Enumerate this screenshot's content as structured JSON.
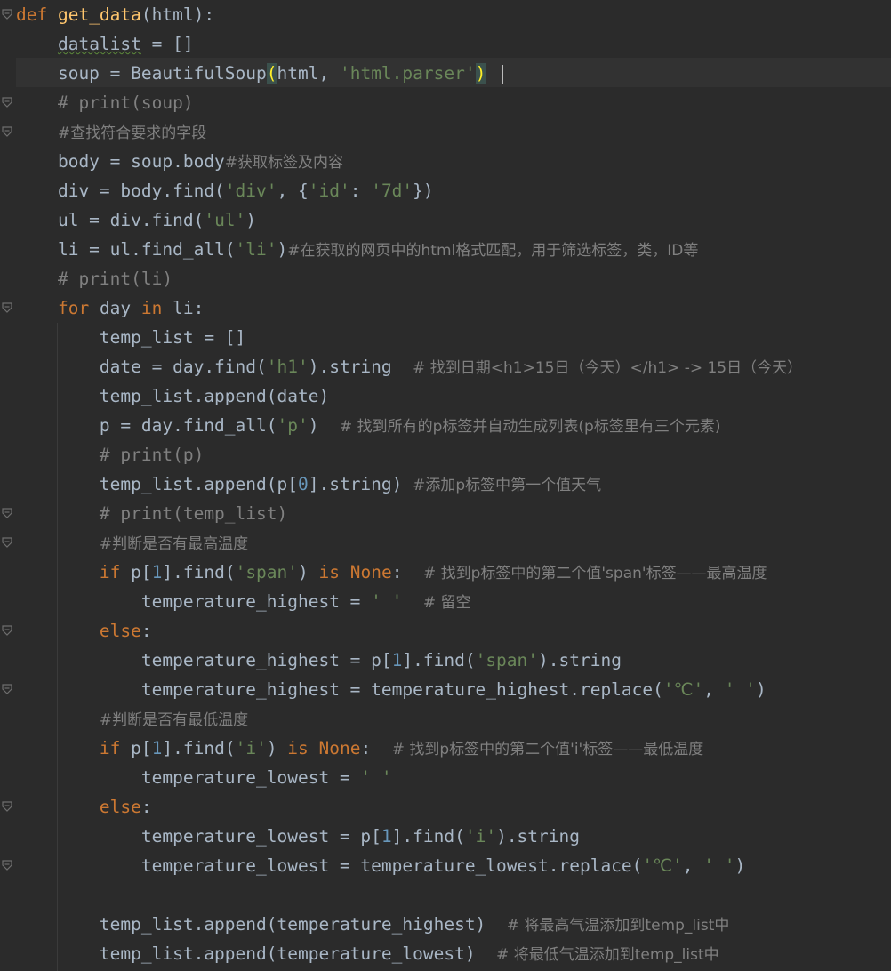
{
  "code_lines": [
    [
      {
        "c": "kw",
        "t": "def "
      },
      {
        "c": "fn",
        "t": "get_data"
      },
      {
        "c": "plain",
        "t": "(html):"
      }
    ],
    [
      {
        "c": "plain",
        "t": "    "
      },
      {
        "c": "plain sq",
        "t": "datalist"
      },
      {
        "c": "plain",
        "t": " = []"
      }
    ],
    [
      {
        "c": "plain",
        "t": "    soup = BeautifulSoup"
      },
      {
        "c": "paren-hl",
        "t": "("
      },
      {
        "c": "plain",
        "t": "html, "
      },
      {
        "c": "str",
        "t": "'html.parser'"
      },
      {
        "c": "paren-hl",
        "t": ")"
      }
    ],
    [
      {
        "c": "plain",
        "t": "    "
      },
      {
        "c": "cm",
        "t": "# print(soup)"
      }
    ],
    [
      {
        "c": "plain",
        "t": "    "
      },
      {
        "c": "cm-cjk",
        "t": "#查找符合要求的字段"
      }
    ],
    [
      {
        "c": "plain",
        "t": "    body = soup.body"
      },
      {
        "c": "cm-cjk",
        "t": "#获取标签及内容"
      }
    ],
    [
      {
        "c": "plain",
        "t": "    div = body.find("
      },
      {
        "c": "str",
        "t": "'div'"
      },
      {
        "c": "plain",
        "t": ", {"
      },
      {
        "c": "str",
        "t": "'id'"
      },
      {
        "c": "plain",
        "t": ": "
      },
      {
        "c": "str",
        "t": "'7d'"
      },
      {
        "c": "plain",
        "t": "})"
      }
    ],
    [
      {
        "c": "plain",
        "t": "    ul = div.find("
      },
      {
        "c": "str",
        "t": "'ul'"
      },
      {
        "c": "plain",
        "t": ")"
      }
    ],
    [
      {
        "c": "plain",
        "t": "    li = ul.find_all("
      },
      {
        "c": "str",
        "t": "'li'"
      },
      {
        "c": "plain",
        "t": ")"
      },
      {
        "c": "cm-cjk",
        "t": "#在获取的网页中的html格式匹配，用于筛选标签，类，ID等"
      }
    ],
    [
      {
        "c": "plain",
        "t": "    "
      },
      {
        "c": "cm",
        "t": "# print(li)"
      }
    ],
    [
      {
        "c": "plain",
        "t": "    "
      },
      {
        "c": "kw",
        "t": "for"
      },
      {
        "c": "plain",
        "t": " day "
      },
      {
        "c": "kw",
        "t": "in"
      },
      {
        "c": "plain",
        "t": " li:"
      }
    ],
    [
      {
        "c": "plain",
        "t": "        temp_list = []"
      }
    ],
    [
      {
        "c": "plain",
        "t": "        date = day.find("
      },
      {
        "c": "str",
        "t": "'h1'"
      },
      {
        "c": "plain",
        "t": ").string  "
      },
      {
        "c": "cm-cjk",
        "t": "# 找到日期<h1>15日（今天）</h1> -> 15日（今天）"
      }
    ],
    [
      {
        "c": "plain",
        "t": "        temp_list.append(date)"
      }
    ],
    [
      {
        "c": "plain",
        "t": "        p = day.find_all("
      },
      {
        "c": "str",
        "t": "'p'"
      },
      {
        "c": "plain",
        "t": ")  "
      },
      {
        "c": "cm-cjk",
        "t": "# 找到所有的p标签并自动生成列表(p标签里有三个元素)"
      }
    ],
    [
      {
        "c": "plain",
        "t": "        "
      },
      {
        "c": "cm",
        "t": "# print(p)"
      }
    ],
    [
      {
        "c": "plain",
        "t": "        temp_list.append(p["
      },
      {
        "c": "num",
        "t": "0"
      },
      {
        "c": "plain",
        "t": "].string) "
      },
      {
        "c": "cm-cjk",
        "t": "#添加p标签中第一个值天气"
      }
    ],
    [
      {
        "c": "plain",
        "t": "        "
      },
      {
        "c": "cm",
        "t": "# print(temp_list)"
      }
    ],
    [
      {
        "c": "plain",
        "t": "        "
      },
      {
        "c": "cm-cjk",
        "t": "#判断是否有最高温度"
      }
    ],
    [
      {
        "c": "plain",
        "t": "        "
      },
      {
        "c": "kw",
        "t": "if"
      },
      {
        "c": "plain",
        "t": " p["
      },
      {
        "c": "num",
        "t": "1"
      },
      {
        "c": "plain",
        "t": "].find("
      },
      {
        "c": "str",
        "t": "'span'"
      },
      {
        "c": "plain",
        "t": ") "
      },
      {
        "c": "kw",
        "t": "is None"
      },
      {
        "c": "plain",
        "t": ":  "
      },
      {
        "c": "cm-cjk",
        "t": "# 找到p标签中的第二个值'span'标签——最高温度"
      }
    ],
    [
      {
        "c": "plain",
        "t": "            temperature_highest = "
      },
      {
        "c": "str",
        "t": "' '"
      },
      {
        "c": "plain",
        "t": "  "
      },
      {
        "c": "cm-cjk",
        "t": "# 留空"
      }
    ],
    [
      {
        "c": "plain",
        "t": "        "
      },
      {
        "c": "kw",
        "t": "else"
      },
      {
        "c": "plain",
        "t": ":"
      }
    ],
    [
      {
        "c": "plain",
        "t": "            temperature_highest = p["
      },
      {
        "c": "num",
        "t": "1"
      },
      {
        "c": "plain",
        "t": "].find("
      },
      {
        "c": "str",
        "t": "'span'"
      },
      {
        "c": "plain",
        "t": ").string"
      }
    ],
    [
      {
        "c": "plain",
        "t": "            temperature_highest = temperature_highest.replace("
      },
      {
        "c": "str",
        "t": "'℃'"
      },
      {
        "c": "plain",
        "t": ", "
      },
      {
        "c": "str",
        "t": "' '"
      },
      {
        "c": "plain",
        "t": ")"
      }
    ],
    [
      {
        "c": "plain",
        "t": "        "
      },
      {
        "c": "cm-cjk",
        "t": "#判断是否有最低温度"
      }
    ],
    [
      {
        "c": "plain",
        "t": "        "
      },
      {
        "c": "kw",
        "t": "if"
      },
      {
        "c": "plain",
        "t": " p["
      },
      {
        "c": "num",
        "t": "1"
      },
      {
        "c": "plain",
        "t": "].find("
      },
      {
        "c": "str",
        "t": "'i'"
      },
      {
        "c": "plain",
        "t": ") "
      },
      {
        "c": "kw",
        "t": "is None"
      },
      {
        "c": "plain",
        "t": ":  "
      },
      {
        "c": "cm-cjk",
        "t": "# 找到p标签中的第二个值'i'标签——最低温度"
      }
    ],
    [
      {
        "c": "plain",
        "t": "            temperature_lowest = "
      },
      {
        "c": "str",
        "t": "' '"
      }
    ],
    [
      {
        "c": "plain",
        "t": "        "
      },
      {
        "c": "kw",
        "t": "else"
      },
      {
        "c": "plain",
        "t": ":"
      }
    ],
    [
      {
        "c": "plain",
        "t": "            temperature_lowest = p["
      },
      {
        "c": "num",
        "t": "1"
      },
      {
        "c": "plain",
        "t": "].find("
      },
      {
        "c": "str",
        "t": "'i'"
      },
      {
        "c": "plain",
        "t": ").string"
      }
    ],
    [
      {
        "c": "plain",
        "t": "            temperature_lowest = temperature_lowest.replace("
      },
      {
        "c": "str",
        "t": "'℃'"
      },
      {
        "c": "plain",
        "t": ", "
      },
      {
        "c": "str",
        "t": "' '"
      },
      {
        "c": "plain",
        "t": ")"
      }
    ],
    [
      {
        "c": "plain",
        "t": ""
      }
    ],
    [
      {
        "c": "plain",
        "t": "        temp_list.append(temperature_highest)  "
      },
      {
        "c": "cm-cjk",
        "t": "# 将最高气温添加到temp_list中"
      }
    ],
    [
      {
        "c": "plain",
        "t": "        temp_list.append(temperature_lowest)  "
      },
      {
        "c": "cm-cjk",
        "t": "# 将最低气温添加到temp_list中"
      }
    ]
  ],
  "fold_markers": [
    0,
    3,
    4,
    10,
    17,
    18,
    21,
    23,
    27,
    29
  ],
  "caret_line": 2,
  "colors": {
    "background": "#2b2b2b",
    "keyword": "#cc7832",
    "function": "#ffc66d",
    "string": "#6a8759",
    "number": "#6897bb",
    "comment": "#808080",
    "text": "#a9b7c6"
  }
}
